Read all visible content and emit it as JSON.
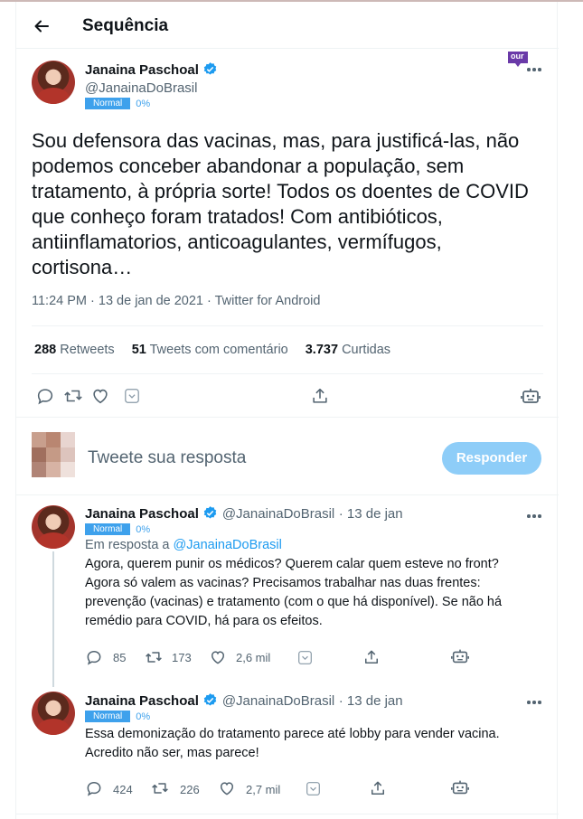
{
  "header": {
    "title": "Sequência"
  },
  "main_tweet": {
    "name": "Janaina Paschoal",
    "handle": "@JanainaDoBrasil",
    "badge": "Normal",
    "percent": "0%",
    "corner_tag": "our",
    "text": "Sou defensora das vacinas, mas, para justificá-las, não podemos conceber abandonar a população, sem tratamento, à própria sorte! Todos os doentes de COVID que conheço foram tratados! Com antibióticos, antiinflamatorios, anticoagulantes, vermífugos, cortisona…",
    "meta": "11:24 PM · 13 de jan de 2021 · Twitter for Android",
    "stats": [
      {
        "value": "288",
        "label": "Retweets"
      },
      {
        "value": "51",
        "label": "Tweets com comentário"
      },
      {
        "value": "3.737",
        "label": "Curtidas"
      }
    ]
  },
  "reply_box": {
    "placeholder": "Tweete sua resposta",
    "button": "Responder"
  },
  "replies": [
    {
      "name": "Janaina Paschoal",
      "handle": "@JanainaDoBrasil",
      "date": "· 13 de jan",
      "badge": "Normal",
      "percent": "0%",
      "reply_to_prefix": "Em resposta a",
      "reply_to_handle": "@JanainaDoBrasil",
      "text": "Agora, querem punir os médicos? Querem calar quem esteve no front? Agora só valem as vacinas? Precisamos trabalhar nas duas frentes: prevenção (vacinas) e tratamento (com o que há disponível). Se não há remédio para COVID, há para os efeitos.",
      "replies": "85",
      "retweets": "173",
      "likes": "2,6 mil"
    },
    {
      "name": "Janaina Paschoal",
      "handle": "@JanainaDoBrasil",
      "date": "· 13 de jan",
      "badge": "Normal",
      "percent": "0%",
      "text": "Essa demonização do tratamento parece até lobby para vender vacina. Acredito não ser, mas parece!",
      "replies": "424",
      "retweets": "226",
      "likes": "2,7 mil"
    }
  ],
  "colors": {
    "accent": "#1d9bf0",
    "badge": "#3ea1ec",
    "reply_button": "#8ecdf8",
    "muted": "#536471"
  }
}
